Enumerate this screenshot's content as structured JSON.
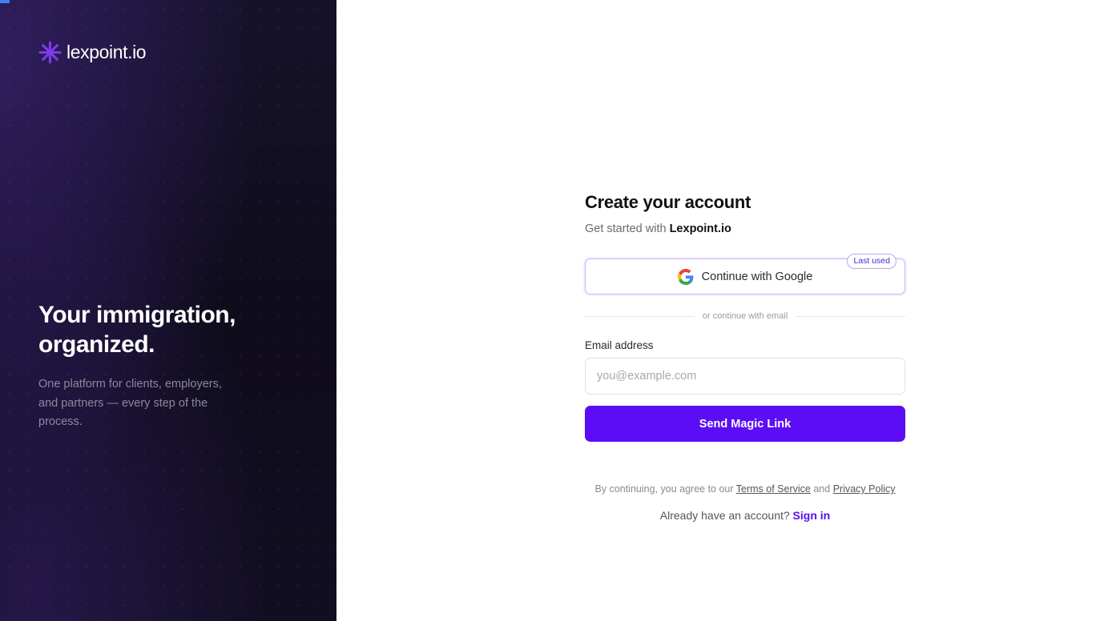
{
  "brand": {
    "name": "lexpoint.io",
    "logo_icon": "asterisk-logo-icon",
    "accent_color": "#5b0df5"
  },
  "hero": {
    "title_line1": "Your immigration,",
    "title_line2": "organized.",
    "subtitle": "One platform for clients, employers, and partners — every step of the process."
  },
  "form": {
    "title": "Create your account",
    "subtitle_prefix": "Get started with",
    "subtitle_brand": "Lexpoint.io",
    "google_button_label": "Continue with Google",
    "google_icon": "google-icon",
    "last_used_badge": "Last used",
    "divider_text": "or continue with email",
    "email_label": "Email address",
    "email_placeholder": "you@example.com",
    "email_value": "",
    "submit_label": "Send Magic Link"
  },
  "legal": {
    "prefix": "By continuing, you agree to our",
    "terms_label": "Terms of Service",
    "and": "and",
    "privacy_label": "Privacy Policy"
  },
  "signin": {
    "prompt": "Already have an account?",
    "link_label": "Sign in"
  }
}
